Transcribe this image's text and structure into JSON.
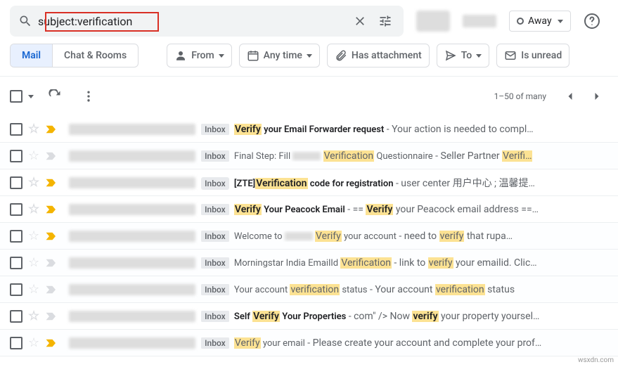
{
  "search": {
    "value": "subject:verification"
  },
  "status": {
    "label": "Away"
  },
  "tabs": {
    "mail": "Mail",
    "chat": "Chat & Rooms"
  },
  "chips": {
    "from": "From",
    "anytime": "Any time",
    "attachment": "Has attachment",
    "to": "To",
    "unread": "Is unread"
  },
  "pagination": {
    "text": "1–50 of many"
  },
  "labels": {
    "inbox": "Inbox"
  },
  "rows": [
    {
      "unread": true,
      "important": true,
      "parts": [
        {
          "hl": true,
          "t": "Verify"
        },
        {
          "t": " your Email Forwarder request"
        },
        {
          "snip": true,
          "t": " - Your action is needed to compl…"
        }
      ]
    },
    {
      "unread": false,
      "important": false,
      "parts": [
        {
          "t": "Final Step: Fill "
        },
        {
          "blur": true
        },
        {
          "t": " "
        },
        {
          "hl": true,
          "t": "Verification"
        },
        {
          "t": " Questionnaire"
        },
        {
          "snip": true,
          "t": " - Seller Partner "
        },
        {
          "hl": true,
          "t": "Verifi…"
        }
      ]
    },
    {
      "unread": true,
      "important": true,
      "parts": [
        {
          "t": "[ZTE]"
        },
        {
          "hl": true,
          "t": "Verification"
        },
        {
          "t": " code for registration"
        },
        {
          "snip": true,
          "t": " - user center 用户中心 ; 温馨提…"
        }
      ]
    },
    {
      "unread": true,
      "important": true,
      "parts": [
        {
          "hl": true,
          "t": "Verify"
        },
        {
          "t": " Your Peacock Email"
        },
        {
          "snip": true,
          "t": " - == "
        },
        {
          "hl": true,
          "t": "Verify"
        },
        {
          "snip": true,
          "t": " your Peacock email address ==…"
        }
      ]
    },
    {
      "unread": false,
      "important": true,
      "parts": [
        {
          "t": "Welcome to "
        },
        {
          "blur": true
        },
        {
          "t": " "
        },
        {
          "hl": true,
          "t": "Verify"
        },
        {
          "t": " your account"
        },
        {
          "snip": true,
          "t": " - need to "
        },
        {
          "hl": true,
          "t": "verify"
        },
        {
          "snip": true,
          "t": " that rupa…"
        }
      ]
    },
    {
      "unread": false,
      "important": false,
      "parts": [
        {
          "t": "Morningstar India EmailId "
        },
        {
          "hl": true,
          "t": "Verification"
        },
        {
          "snip": true,
          "t": " - link to "
        },
        {
          "hl": true,
          "t": "verify"
        },
        {
          "snip": true,
          "t": " your emailid. Clic…"
        }
      ]
    },
    {
      "unread": false,
      "important": false,
      "parts": [
        {
          "t": "Your account "
        },
        {
          "hl": true,
          "t": "verification"
        },
        {
          "t": " status"
        },
        {
          "snip": true,
          "t": " - Your account "
        },
        {
          "hl": true,
          "t": "verification"
        },
        {
          "snip": true,
          "t": " status"
        }
      ]
    },
    {
      "unread": true,
      "important": false,
      "parts": [
        {
          "t": "Self "
        },
        {
          "hl": true,
          "t": "Verify"
        },
        {
          "t": " Your Properties"
        },
        {
          "snip": true,
          "t": " - com\" /> Now "
        },
        {
          "hl": true,
          "t": "verify"
        },
        {
          "snip": true,
          "t": " your property yoursel…"
        }
      ]
    },
    {
      "unread": false,
      "important": true,
      "parts": [
        {
          "hl": true,
          "t": "Verify"
        },
        {
          "t": " your email"
        },
        {
          "snip": true,
          "t": " - Please create your account and complete your prof…"
        }
      ]
    }
  ],
  "watermark": "wsxdn.com"
}
